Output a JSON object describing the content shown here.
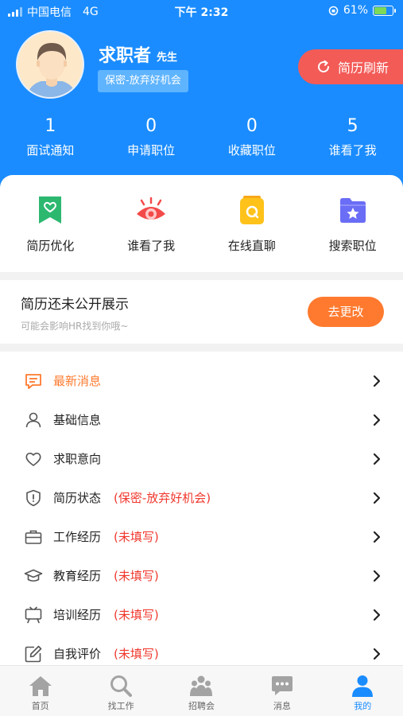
{
  "status_bar": {
    "carrier": "中国电信",
    "network": "4G",
    "time": "下午 2:32",
    "battery": "61%"
  },
  "profile": {
    "name": "求职者",
    "title": "先生",
    "privacy_badge": "保密-放弃好机会",
    "refresh_label": "简历刷新"
  },
  "stats": [
    {
      "value": "1",
      "label": "面试通知"
    },
    {
      "value": "0",
      "label": "申请职位"
    },
    {
      "value": "0",
      "label": "收藏职位"
    },
    {
      "value": "5",
      "label": "谁看了我"
    }
  ],
  "quick_actions": [
    {
      "label": "简历优化",
      "icon": "bookmark-heart-icon",
      "color": "#2db870"
    },
    {
      "label": "谁看了我",
      "icon": "eye-icon",
      "color": "#f34a4a"
    },
    {
      "label": "在线直聊",
      "icon": "chat-icon",
      "color": "#ffc21a"
    },
    {
      "label": "搜索职位",
      "icon": "folder-star-icon",
      "color": "#6a6df5"
    }
  ],
  "notice": {
    "title": "简历还未公开展示",
    "subtitle": "可能会影响HR找到你哦~",
    "button": "去更改"
  },
  "menu": [
    {
      "label": "最新消息",
      "icon": "message-icon",
      "extra": ""
    },
    {
      "label": "基础信息",
      "icon": "user-icon",
      "extra": ""
    },
    {
      "label": "求职意向",
      "icon": "heart-icon",
      "extra": ""
    },
    {
      "label": "简历状态",
      "icon": "shield-icon",
      "extra": "(保密-放弃好机会)"
    },
    {
      "label": "工作经历",
      "icon": "briefcase-icon",
      "extra": "(未填写)"
    },
    {
      "label": "教育经历",
      "icon": "graduation-cap-icon",
      "extra": "(未填写)"
    },
    {
      "label": "培训经历",
      "icon": "presentation-board-icon",
      "extra": "(未填写)"
    },
    {
      "label": "自我评价",
      "icon": "edit-icon",
      "extra": "(未填写)"
    }
  ],
  "tabs": [
    {
      "label": "首页",
      "icon": "home-icon"
    },
    {
      "label": "找工作",
      "icon": "search-icon"
    },
    {
      "label": "招聘会",
      "icon": "job-fair-icon"
    },
    {
      "label": "消息",
      "icon": "chat-bubble-icon"
    },
    {
      "label": "我的",
      "icon": "person-icon",
      "active": true
    }
  ],
  "colors": {
    "primary": "#1a8cff",
    "accent_orange": "#ff7a2f",
    "refresh_red": "#f35b57",
    "warning_red": "#f0382e"
  }
}
